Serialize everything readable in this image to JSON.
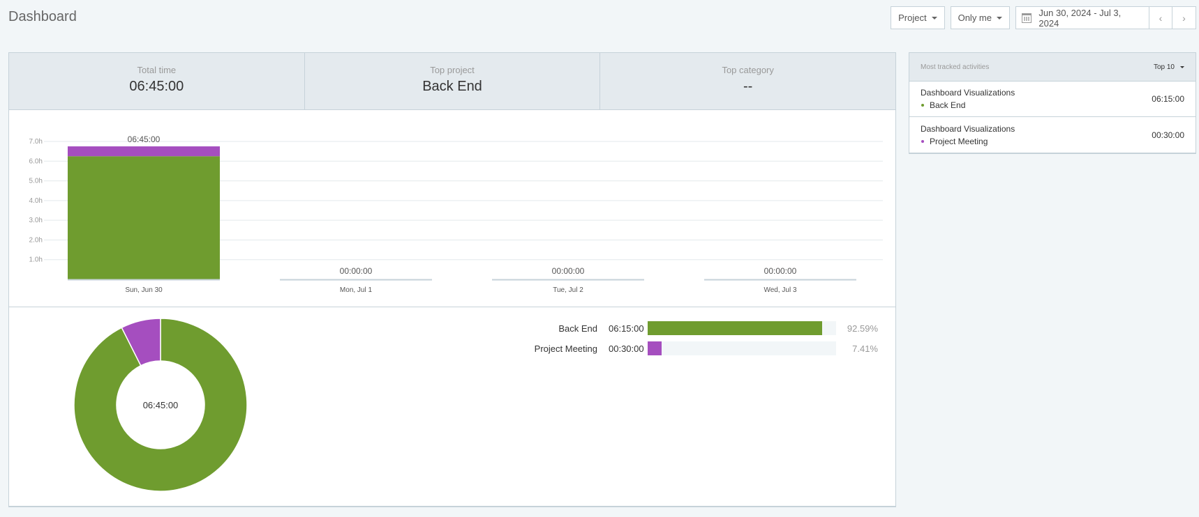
{
  "page": {
    "title": "Dashboard"
  },
  "filters": {
    "group_label": "Project",
    "user_label": "Only me",
    "date_range": "Jun 30, 2024 - Jul 3, 2024",
    "prev": "‹",
    "next": "›"
  },
  "stats": {
    "total_time_label": "Total time",
    "total_time_value": "06:45:00",
    "top_project_label": "Top project",
    "top_project_value": "Back End",
    "top_category_label": "Top category",
    "top_category_value": "--"
  },
  "colors": {
    "back_end": "#6f9c2f",
    "project_meeting": "#a54ebf",
    "gridline": "#e3e9ec",
    "axis": "#c6d2d9"
  },
  "chart_data": [
    {
      "type": "bar",
      "stacked": true,
      "categories": [
        "Sun, Jun 30",
        "Mon, Jul 1",
        "Tue, Jul 2",
        "Wed, Jul 3"
      ],
      "series": [
        {
          "name": "Back End",
          "values": [
            6.25,
            0,
            0,
            0
          ]
        },
        {
          "name": "Project Meeting",
          "values": [
            0.5,
            0,
            0,
            0
          ]
        }
      ],
      "total_labels": [
        "06:45:00",
        "00:00:00",
        "00:00:00",
        "00:00:00"
      ],
      "y_ticks": [
        "1.0h",
        "2.0h",
        "3.0h",
        "4.0h",
        "5.0h",
        "6.0h",
        "7.0h"
      ],
      "ylim": [
        0,
        7
      ],
      "grid": true
    },
    {
      "type": "pie",
      "donut": true,
      "center_label": "06:45:00",
      "slices": [
        {
          "name": "Back End",
          "value": 6.25
        },
        {
          "name": "Project Meeting",
          "value": 0.5
        }
      ]
    }
  ],
  "breakdown": [
    {
      "name": "Back End",
      "time": "06:15:00",
      "percent_label": "92.59%",
      "percent": 92.59
    },
    {
      "name": "Project Meeting",
      "time": "00:30:00",
      "percent_label": "7.41%",
      "percent": 7.41
    }
  ],
  "activities_panel": {
    "title": "Most tracked activities",
    "top_label": "Top 10",
    "items": [
      {
        "title": "Dashboard Visualizations",
        "project": "Back End",
        "time": "06:15:00"
      },
      {
        "title": "Dashboard Visualizations",
        "project": "Project Meeting",
        "time": "00:30:00"
      }
    ]
  }
}
